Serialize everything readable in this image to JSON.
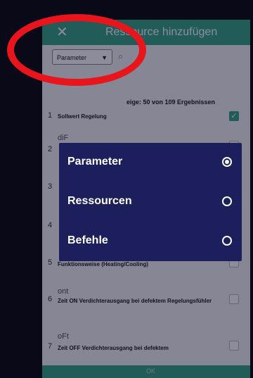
{
  "header": {
    "close_icon": "close-icon",
    "title": "Ressource hinzufügen"
  },
  "filter": {
    "selected": "Parameter",
    "search_icon": "search-icon"
  },
  "results_text": "eige: 50 von 109 Ergebnissen",
  "rows": [
    {
      "num": "1",
      "code": "",
      "desc": "Sollwert Regelung",
      "checked": true
    },
    {
      "num": "2",
      "code": "diF",
      "desc": "",
      "checked": false
    },
    {
      "num": "3",
      "code": "",
      "desc": "",
      "checked": false
    },
    {
      "num": "4",
      "code": "",
      "desc": "",
      "checked": false
    },
    {
      "num": "5",
      "code": "",
      "desc": "Funktionsweise (Heating/Cooling)",
      "checked": false
    },
    {
      "num": "6",
      "code": "ont",
      "desc": "Zeit ON Verdichterausgang bei defektem Regelungsfühler",
      "checked": false
    },
    {
      "num": "7",
      "code": "oFt",
      "desc": "Zeit OFF Verdichterausgang bei defektem",
      "checked": false
    }
  ],
  "footer": {
    "ok_label": "OK"
  },
  "dialog": {
    "options": [
      {
        "label": "Parameter",
        "selected": true
      },
      {
        "label": "Ressourcen",
        "selected": false
      },
      {
        "label": "Befehle",
        "selected": false
      }
    ]
  },
  "colors": {
    "accent": "#3fa889",
    "dialog_bg": "#1c1f5c",
    "annotation": "#e8151c"
  }
}
